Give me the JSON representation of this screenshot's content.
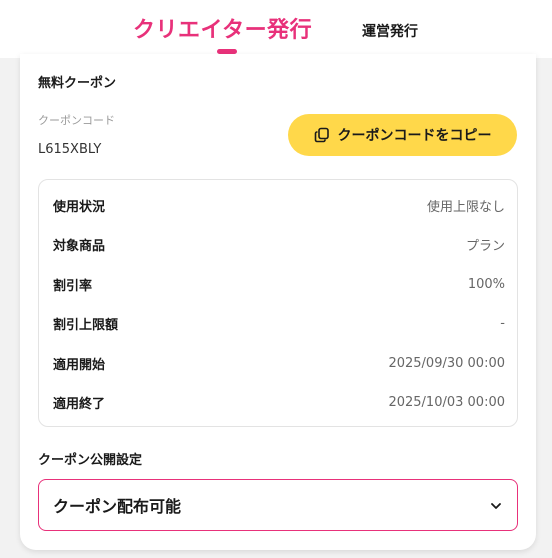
{
  "tabs": {
    "creator_label": "クリエイター発行",
    "admin_label": "運営発行",
    "active_color": "#e8317a"
  },
  "coupon": {
    "title": "無料クーポン",
    "code_label": "クーポンコード",
    "code_value": "L615XBLY",
    "copy_button_label": "クーポンコードをコピー",
    "copy_icon": "copy-icon",
    "button_color": "#ffd84a"
  },
  "details": [
    {
      "label": "使用状況",
      "value": "使用上限なし"
    },
    {
      "label": "対象商品",
      "value": "プラン"
    },
    {
      "label": "割引率",
      "value": "100%"
    },
    {
      "label": "割引上限額",
      "value": "-"
    },
    {
      "label": "適用開始",
      "value": "2025/09/30 00:00"
    },
    {
      "label": "適用終了",
      "value": "2025/10/03 00:00"
    }
  ],
  "visibility": {
    "title": "クーポン公開設定",
    "selected_option": "クーポン配布可能",
    "dropdown_icon": "chevron-down-icon"
  }
}
